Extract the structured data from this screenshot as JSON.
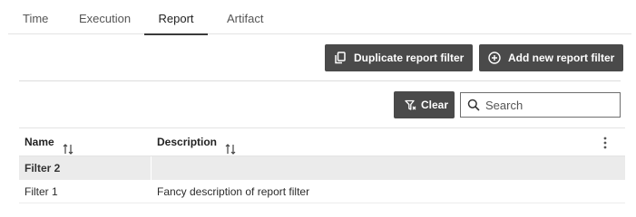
{
  "tabs": [
    {
      "label": "Time",
      "active": false
    },
    {
      "label": "Execution",
      "active": false
    },
    {
      "label": "Report",
      "active": true
    },
    {
      "label": "Artifact",
      "active": false
    }
  ],
  "toolbar": {
    "duplicate_label": "Duplicate report filter",
    "add_label": "Add new report filter",
    "clear_label": "Clear"
  },
  "search": {
    "placeholder": "Search",
    "value": ""
  },
  "table": {
    "columns": [
      {
        "label": "Name",
        "icon": "sort-icon"
      },
      {
        "label": "Description",
        "icon": "sort-icon"
      }
    ],
    "rows": [
      {
        "name": "Filter 2",
        "description": ""
      },
      {
        "name": "Filter 1",
        "description": "Fancy description of report filter"
      }
    ]
  },
  "colors": {
    "button_bg": "#4a4a4a",
    "active_tab_underline": "#3a3a3a",
    "shaded_row": "#ebebeb"
  }
}
